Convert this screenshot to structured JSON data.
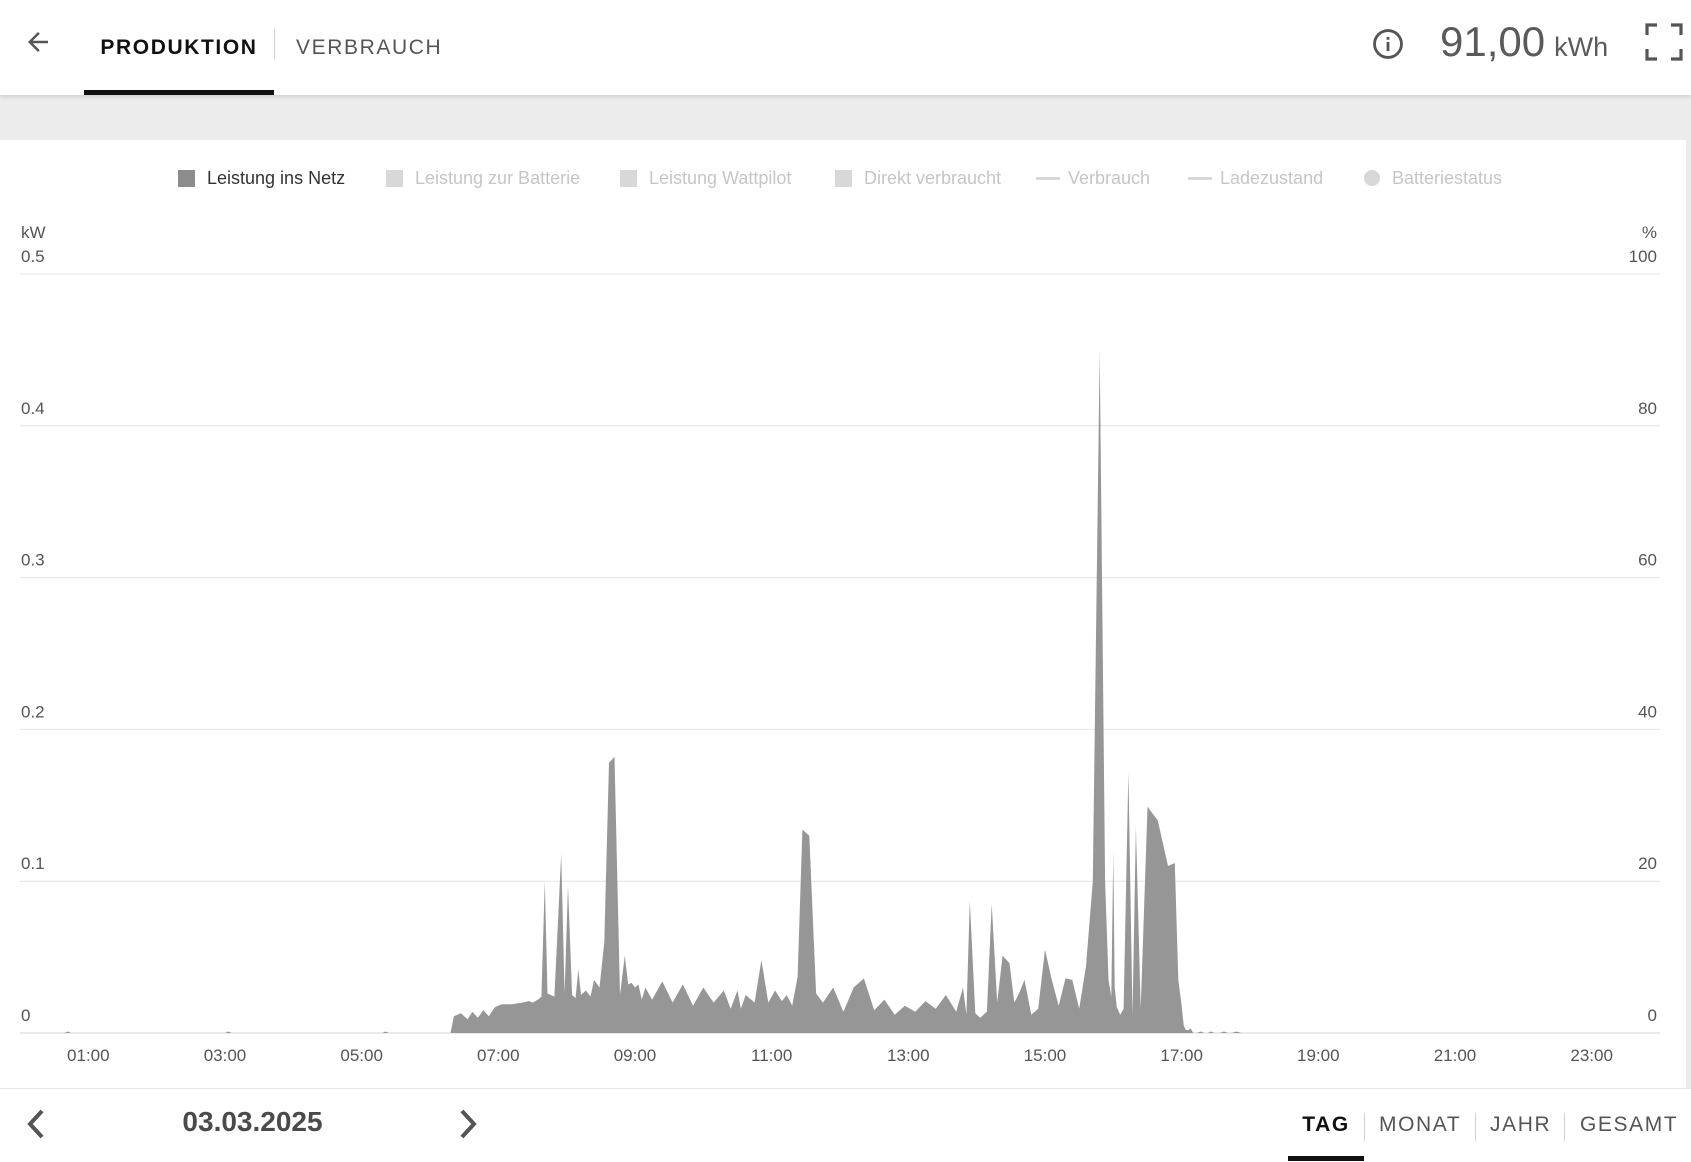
{
  "header": {
    "tabs": [
      {
        "label": "PRODUKTION",
        "active": true
      },
      {
        "label": "VERBRAUCH",
        "active": false
      }
    ],
    "total_value": "91,00",
    "total_unit": "kWh",
    "icons": {
      "back": "arrow-left-icon",
      "info": "info-circle-icon",
      "fullscreen": "fullscreen-icon"
    }
  },
  "legend": [
    {
      "label": "Leistung ins Netz",
      "swatch": "square",
      "active": true
    },
    {
      "label": "Leistung zur Batterie",
      "swatch": "square",
      "active": false
    },
    {
      "label": "Leistung Wattpilot",
      "swatch": "square",
      "active": false
    },
    {
      "label": "Direkt verbraucht",
      "swatch": "square",
      "active": false
    },
    {
      "label": "Verbrauch",
      "swatch": "line",
      "active": false
    },
    {
      "label": "Ladezustand",
      "swatch": "line",
      "active": false
    },
    {
      "label": "Batteriestatus",
      "swatch": "dot",
      "active": false
    }
  ],
  "chart_data": {
    "type": "area",
    "left_axis": {
      "unit": "kW",
      "ticks": [
        "0",
        "0.1",
        "0.2",
        "0.3",
        "0.4",
        "0.5"
      ],
      "ylim": [
        0,
        0.5
      ]
    },
    "right_axis": {
      "unit": "%",
      "ticks": [
        "0",
        "20",
        "40",
        "60",
        "80",
        "100"
      ],
      "ylim": [
        0,
        100
      ]
    },
    "x_ticks": [
      "01:00",
      "03:00",
      "05:00",
      "07:00",
      "09:00",
      "11:00",
      "13:00",
      "15:00",
      "17:00",
      "19:00",
      "21:00",
      "23:00"
    ],
    "xlim_hours": [
      0,
      24
    ],
    "grid": true,
    "colors": {
      "area": "#969696",
      "grid": "#e4e4e4"
    },
    "series": [
      {
        "name": "Leistung ins Netz",
        "unit": "kW",
        "x_hours": [
          0,
          0.65,
          0.7,
          0.75,
          3.0,
          3.05,
          3.1,
          5.3,
          5.35,
          5.4,
          6.3,
          6.35,
          6.45,
          6.55,
          6.62,
          6.7,
          6.78,
          6.86,
          6.95,
          7.05,
          7.2,
          7.35,
          7.45,
          7.5,
          7.58,
          7.63,
          7.68,
          7.72,
          7.82,
          7.92,
          7.97,
          8.02,
          8.08,
          8.13,
          8.17,
          8.21,
          8.28,
          8.35,
          8.4,
          8.48,
          8.55,
          8.62,
          8.7,
          8.78,
          8.85,
          8.9,
          8.95,
          9.0,
          9.05,
          9.1,
          9.15,
          9.25,
          9.4,
          9.55,
          9.7,
          9.85,
          10.0,
          10.15,
          10.3,
          10.4,
          10.5,
          10.55,
          10.62,
          10.75,
          10.85,
          10.95,
          11.05,
          11.15,
          11.22,
          11.3,
          11.38,
          11.45,
          11.55,
          11.65,
          11.75,
          11.9,
          12.05,
          12.2,
          12.35,
          12.5,
          12.65,
          12.8,
          12.95,
          13.1,
          13.25,
          13.4,
          13.55,
          13.7,
          13.8,
          13.85,
          13.9,
          13.98,
          14.05,
          14.15,
          14.22,
          14.3,
          14.38,
          14.48,
          14.55,
          14.62,
          14.7,
          14.8,
          14.9,
          15.0,
          15.1,
          15.2,
          15.3,
          15.4,
          15.5,
          15.6,
          15.7,
          15.8,
          15.88,
          15.93,
          15.97,
          16.0,
          16.02,
          16.05,
          16.1,
          16.15,
          16.22,
          16.28,
          16.33,
          16.4,
          16.5,
          16.65,
          16.8,
          16.9,
          16.95,
          17.0,
          17.03,
          17.06,
          17.1,
          17.13,
          17.17,
          17.22,
          17.28,
          17.33,
          17.38,
          17.43,
          17.48,
          17.55,
          17.62,
          17.68,
          17.73,
          17.8,
          17.88,
          17.95,
          18.02,
          18.1,
          18.2,
          18.3,
          18.5,
          18.55,
          18.6,
          19.2,
          19.25,
          19.3,
          19.5,
          19.55,
          19.6,
          20.1,
          20.15,
          20.2,
          20.55,
          20.6,
          20.65,
          21.85,
          21.9,
          21.95,
          24.0
        ],
        "values": [
          0,
          0,
          0.001,
          0,
          0,
          0.001,
          0,
          0,
          0.001,
          0,
          0,
          0.011,
          0.013,
          0.009,
          0.014,
          0.01,
          0.015,
          0.011,
          0.017,
          0.019,
          0.019,
          0.02,
          0.021,
          0.02,
          0.022,
          0.024,
          0.1,
          0.026,
          0.024,
          0.118,
          0.026,
          0.097,
          0.025,
          0.023,
          0.042,
          0.025,
          0.028,
          0.024,
          0.035,
          0.03,
          0.06,
          0.178,
          0.182,
          0.025,
          0.051,
          0.032,
          0.033,
          0.03,
          0.032,
          0.022,
          0.03,
          0.022,
          0.034,
          0.02,
          0.032,
          0.018,
          0.03,
          0.02,
          0.028,
          0.016,
          0.028,
          0.016,
          0.025,
          0.02,
          0.048,
          0.02,
          0.028,
          0.021,
          0.025,
          0.018,
          0.037,
          0.134,
          0.13,
          0.026,
          0.02,
          0.03,
          0.014,
          0.03,
          0.036,
          0.015,
          0.022,
          0.012,
          0.018,
          0.014,
          0.021,
          0.016,
          0.025,
          0.014,
          0.03,
          0.012,
          0.087,
          0.013,
          0.01,
          0.014,
          0.085,
          0.02,
          0.051,
          0.046,
          0.02,
          0.026,
          0.035,
          0.012,
          0.016,
          0.055,
          0.035,
          0.018,
          0.036,
          0.035,
          0.016,
          0.044,
          0.1,
          0.449,
          0.1,
          0.035,
          0.024,
          0.119,
          0.03,
          0.017,
          0.012,
          0.016,
          0.172,
          0.012,
          0.136,
          0.016,
          0.149,
          0.14,
          0.11,
          0.112,
          0.035,
          0.018,
          0.005,
          0.002,
          0.002,
          0.003,
          0,
          0,
          0.001,
          0,
          0,
          0.001,
          0,
          0,
          0.001,
          0,
          0,
          0.001,
          0,
          0
        ]
      }
    ]
  },
  "footer": {
    "date": "03.03.2025",
    "periods": [
      {
        "label": "TAG",
        "active": true
      },
      {
        "label": "MONAT",
        "active": false
      },
      {
        "label": "JAHR",
        "active": false
      },
      {
        "label": "GESAMT",
        "active": false
      }
    ],
    "icons": {
      "prev": "chevron-left-icon",
      "next": "chevron-right-icon"
    }
  }
}
